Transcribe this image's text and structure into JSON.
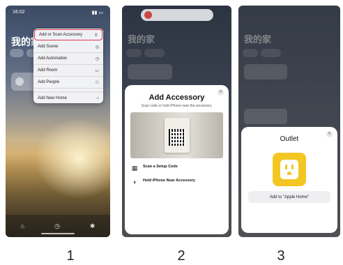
{
  "labels": [
    "1",
    "2",
    "3"
  ],
  "screen1": {
    "time": "16:02",
    "home_title": "我的家",
    "menu": [
      {
        "label": "Add or Scan Accessory",
        "icon": "scan-icon",
        "glyph": "⚲"
      },
      {
        "label": "Add Scene",
        "icon": "scene-icon",
        "glyph": "◎"
      },
      {
        "label": "Add Automation",
        "icon": "automation-icon",
        "glyph": "◷"
      },
      {
        "label": "Add Room",
        "icon": "room-icon",
        "glyph": "▭"
      },
      {
        "label": "Add People",
        "icon": "people-icon",
        "glyph": "⚇"
      },
      {
        "label": "Add New Home",
        "icon": "home-icon",
        "glyph": "⌂"
      }
    ],
    "tabs": [
      {
        "icon": "home-tab-icon",
        "glyph": "⌂"
      },
      {
        "icon": "automation-tab-icon",
        "glyph": "◷"
      },
      {
        "icon": "discover-tab-icon",
        "glyph": "✱"
      }
    ]
  },
  "screen2": {
    "sheet_title": "Add Accessory",
    "sheet_subtitle": "Scan code or hold iPhone near the accessory.",
    "options": [
      {
        "title": "Scan a Setup Code",
        "icon": "qr-code-icon",
        "glyph": "▦"
      },
      {
        "title": "Hold iPhone Near Accessory",
        "icon": "nfc-icon",
        "glyph": "◖"
      }
    ]
  },
  "screen3": {
    "sheet_title": "Outlet",
    "button_label": "Add to \"Apple Home\""
  }
}
